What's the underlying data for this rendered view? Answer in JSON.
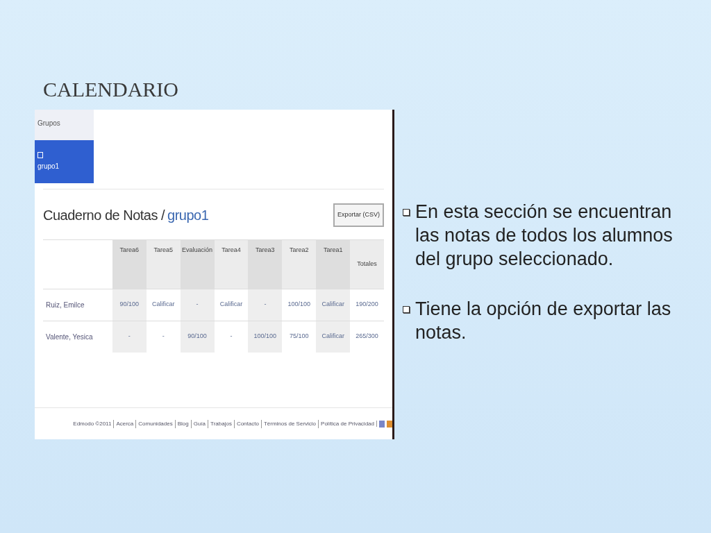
{
  "slide_title": "CALENDARIO",
  "screenshot": {
    "sidebar": {
      "heading": "Grupos",
      "items": [
        {
          "label": "grupo1",
          "selected": true
        }
      ]
    },
    "page_title": "Cuaderno de Notas /",
    "page_title_group": "grupo1",
    "export_button": "Exportar (CSV)",
    "table": {
      "columns": [
        "Tarea6",
        "Tarea5",
        "Evaluación",
        "Tarea4",
        "Tarea3",
        "Tarea2",
        "Tarea1",
        "Totales"
      ],
      "rows": [
        {
          "name": "Ruiz, Emilce",
          "cells": [
            "90/100",
            "Calificar",
            "-",
            "Calificar",
            "-",
            "100/100",
            "Calificar",
            "190/200"
          ]
        },
        {
          "name": "Valente, Yesica",
          "cells": [
            "-",
            "-",
            "90/100",
            "-",
            "100/100",
            "75/100",
            "Calificar",
            "265/300"
          ]
        }
      ]
    },
    "footer": [
      "Edmodo ©2011",
      "Acerca",
      "Comunidades",
      "Blog",
      "Guía",
      "Trabajos",
      "Contacto",
      "Términos de Servicio",
      "Política de Privacidad"
    ]
  },
  "bullets": [
    "En esta sección se encuentran las notas de todos los alumnos del grupo seleccionado.",
    "Tiene la opción de exportar las notas."
  ]
}
